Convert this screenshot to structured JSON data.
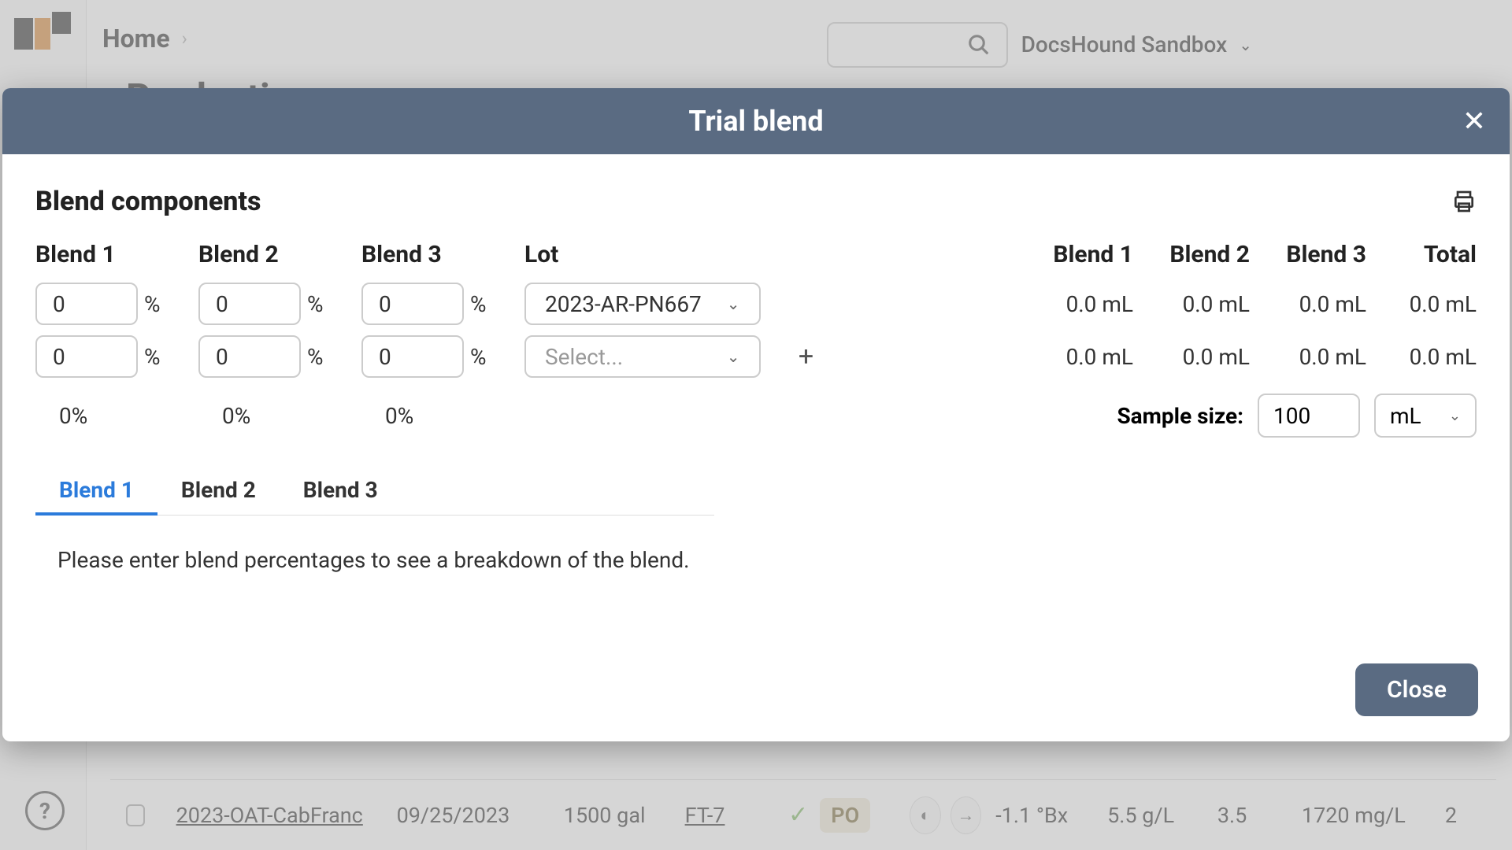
{
  "header": {
    "home": "Home",
    "page_title": "Production",
    "workspace": "DocsHound Sandbox"
  },
  "modal": {
    "title": "Trial blend",
    "section_title": "Blend components",
    "columns": {
      "blend1": "Blend 1",
      "blend2": "Blend 2",
      "blend3": "Blend 3",
      "lot": "Lot",
      "total": "Total"
    },
    "rows": [
      {
        "pct1": "0",
        "pct2": "0",
        "pct3": "0",
        "lot": "2023-AR-PN667",
        "lot_is_placeholder": false,
        "out1": "0.0 mL",
        "out2": "0.0 mL",
        "out3": "0.0 mL",
        "total": "0.0 mL",
        "show_plus": false
      },
      {
        "pct1": "0",
        "pct2": "0",
        "pct3": "0",
        "lot": "Select...",
        "lot_is_placeholder": true,
        "out1": "0.0 mL",
        "out2": "0.0 mL",
        "out3": "0.0 mL",
        "total": "0.0 mL",
        "show_plus": true
      }
    ],
    "totals": {
      "pct1": "0%",
      "pct2": "0%",
      "pct3": "0%"
    },
    "sample_size": {
      "label": "Sample size:",
      "value": "100",
      "unit": "mL"
    },
    "tabs": [
      "Blend 1",
      "Blend 2",
      "Blend 3"
    ],
    "active_tab": 0,
    "tab_message": "Please enter blend percentages to see a breakdown of the blend.",
    "close_label": "Close"
  },
  "bg_table": {
    "row2": {
      "lot": "2023-OAT-CabFranc",
      "date": "09/25/2023",
      "volume": "1500 gal",
      "tank": "FT-7",
      "tag": "PO",
      "brix": "-1.1 °Bx",
      "ta": "5.5 g/L",
      "ph": "3.5",
      "so2": "1720 mg/L",
      "trailing": "2"
    }
  }
}
